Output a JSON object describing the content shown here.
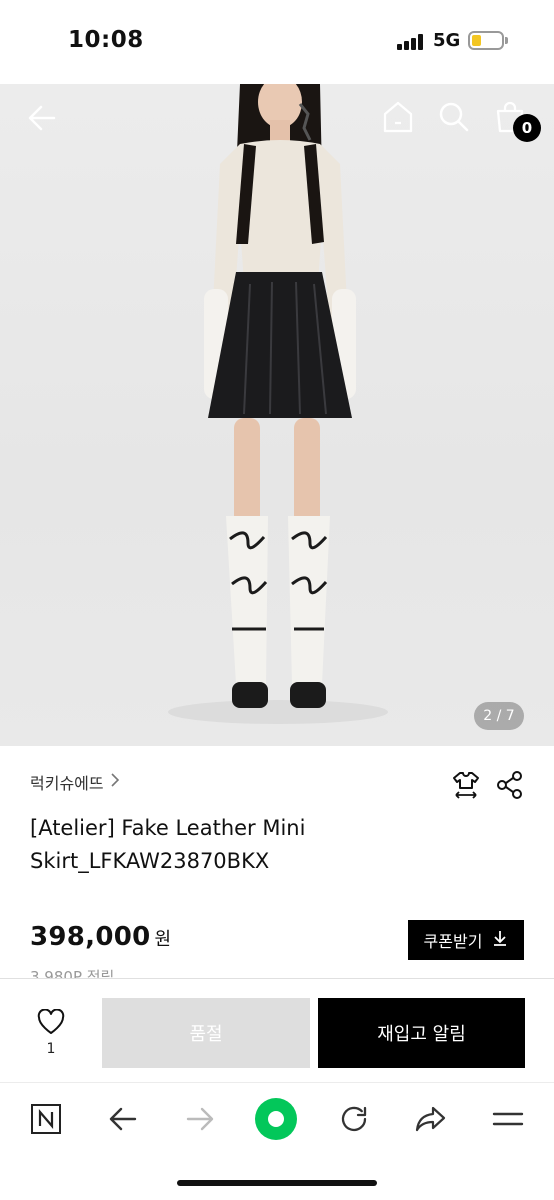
{
  "status_bar": {
    "time": "10:08",
    "network": "5G"
  },
  "hero": {
    "image_counter": "2 / 7",
    "cart_count": "0"
  },
  "product": {
    "brand": "럭키슈에뜨",
    "title": "[Atelier] Fake Leather Mini Skirt_LFKAW23870BKX",
    "price": "398,000",
    "currency": "원",
    "coupon_label": "쿠폰받기",
    "points_text": "3,980P 적립"
  },
  "action_bar": {
    "like_count": "1",
    "soldout_label": "품절",
    "restock_label": "재입고 알림"
  },
  "colors": {
    "accent": "#000000",
    "naver_green": "#03c75a",
    "soldout_bg": "#dedede",
    "battery": "#f3c623"
  },
  "icons": {
    "hero": [
      "back-arrow-icon",
      "home-icon",
      "search-icon",
      "shopping-bag-icon"
    ],
    "info": [
      "size-guide-icon",
      "share-icon"
    ],
    "browser": [
      "naver-n-icon",
      "back-icon",
      "forward-icon",
      "green-dot-icon",
      "refresh-icon",
      "share-arrow-icon",
      "menu-icon"
    ]
  }
}
